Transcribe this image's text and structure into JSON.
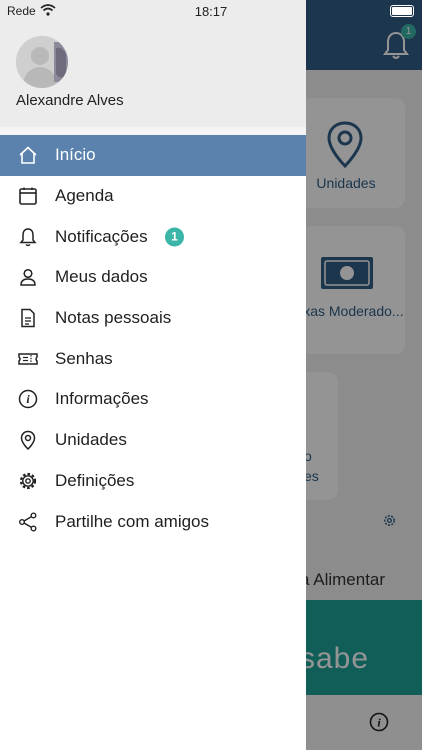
{
  "status_bar": {
    "carrier": "Rede",
    "time": "18:17"
  },
  "user": {
    "name": "Alexandre Alves"
  },
  "menu": [
    {
      "label": "Início",
      "icon": "home-icon",
      "active": true
    },
    {
      "label": "Agenda",
      "icon": "calendar-icon"
    },
    {
      "label": "Notificações",
      "icon": "bell-icon",
      "badge": "1"
    },
    {
      "label": "Meus dados",
      "icon": "person-icon"
    },
    {
      "label": "Notas pessoais",
      "icon": "document-icon"
    },
    {
      "label": "Senhas",
      "icon": "ticket-icon"
    },
    {
      "label": "Informações",
      "icon": "info-icon"
    },
    {
      "label": "Unidades",
      "icon": "location-pin-icon"
    },
    {
      "label": "Definições",
      "icon": "gear-icon"
    },
    {
      "label": "Partilhe com amigos",
      "icon": "share-icon"
    }
  ],
  "background": {
    "notification_count": "1",
    "cards": {
      "unidades": "Unidades",
      "taxas": "Taxas Moderado...",
      "partial_line1": "o",
      "partial_line2": "es"
    },
    "section_title": "a Alimentar",
    "banner_text": "sabe"
  },
  "colors": {
    "header_blue": "#2f5d86",
    "active_item": "#5a82ad",
    "badge_teal": "#3bb5a8",
    "banner_teal": "#1ea39a"
  }
}
